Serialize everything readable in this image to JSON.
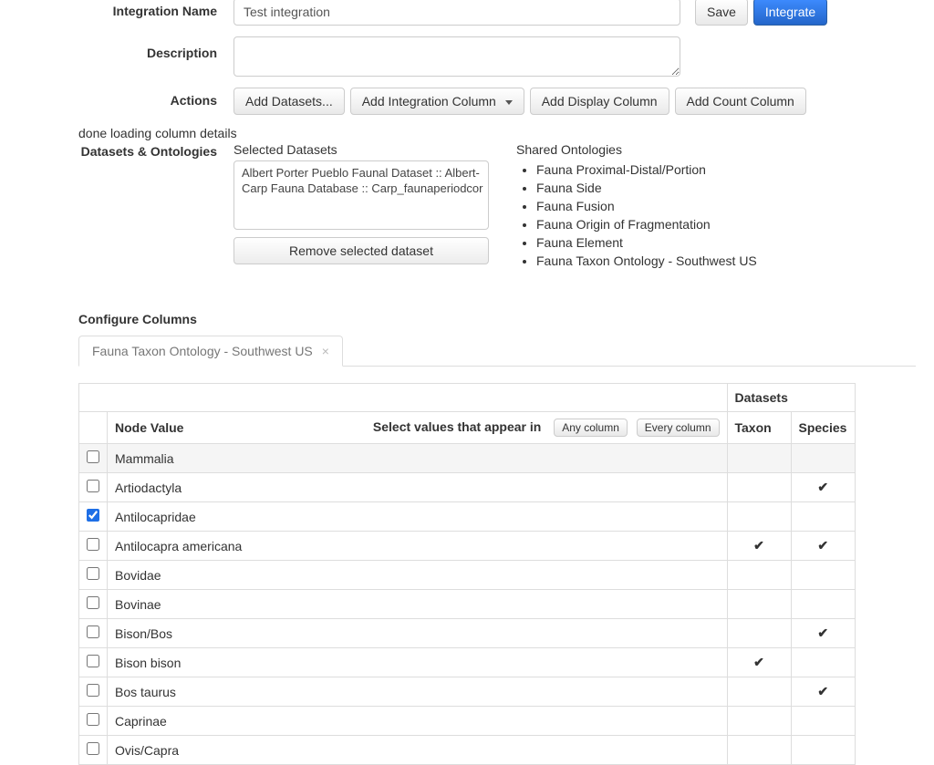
{
  "form": {
    "integrationName": {
      "label": "Integration Name",
      "value": "Test integration"
    },
    "description": {
      "label": "Description",
      "value": ""
    },
    "actions": {
      "label": "Actions",
      "addDatasets": "Add Datasets...",
      "addIntegrationColumn": "Add Integration Column",
      "addDisplayColumn": "Add Display Column",
      "addCountColumn": "Add Count Column"
    },
    "save": "Save",
    "integrate": "Integrate"
  },
  "status": "done loading column details",
  "datasetsOntologies": {
    "label": "Datasets & Ontologies",
    "selectedHeader": "Selected Datasets",
    "selected": [
      "Albert Porter Pueblo Faunal Dataset :: Albert-",
      "Carp Fauna Database :: Carp_faunaperiodcor"
    ],
    "removeBtn": "Remove selected dataset",
    "sharedHeader": "Shared Ontologies",
    "ontologies": [
      "Fauna Proximal-Distal/Portion",
      "Fauna Side",
      "Fauna Fusion",
      "Fauna Origin of Fragmentation",
      "Fauna Element",
      "Fauna Taxon Ontology - Southwest US"
    ]
  },
  "configure": {
    "title": "Configure Columns",
    "tabLabel": "Fauna Taxon Ontology - Southwest US"
  },
  "table": {
    "datasetsHeader": "Datasets",
    "nodeHeader": "Node Value",
    "filterLabel": "Select values that appear in",
    "anyBtn": "Any column",
    "everyBtn": "Every column",
    "taxonHeader": "Taxon",
    "speciesHeader": "Species",
    "rows": [
      {
        "label": "Mammalia",
        "indent": 1,
        "checked": false,
        "taxon": false,
        "species": false,
        "shade": true
      },
      {
        "label": "Artiodactyla",
        "indent": 2,
        "checked": false,
        "taxon": false,
        "species": true
      },
      {
        "label": "Antilocapridae",
        "indent": 3,
        "checked": true,
        "taxon": false,
        "species": false
      },
      {
        "label": "Antilocapra americana",
        "indent": 4,
        "checked": false,
        "taxon": true,
        "species": true
      },
      {
        "label": "Bovidae",
        "indent": 3,
        "checked": false,
        "taxon": false,
        "species": false
      },
      {
        "label": "Bovinae",
        "indent": 4,
        "checked": false,
        "taxon": false,
        "species": false
      },
      {
        "label": "Bison/Bos",
        "indent": 5,
        "checked": false,
        "taxon": false,
        "species": true
      },
      {
        "label": "Bison bison",
        "indent": 5,
        "checked": false,
        "taxon": true,
        "species": false
      },
      {
        "label": "Bos taurus",
        "indent": 5,
        "checked": false,
        "taxon": false,
        "species": true
      },
      {
        "label": "Caprinae",
        "indent": 4,
        "checked": false,
        "taxon": false,
        "species": false
      },
      {
        "label": "Ovis/Capra",
        "indent": 5,
        "checked": false,
        "taxon": false,
        "species": false
      }
    ]
  }
}
